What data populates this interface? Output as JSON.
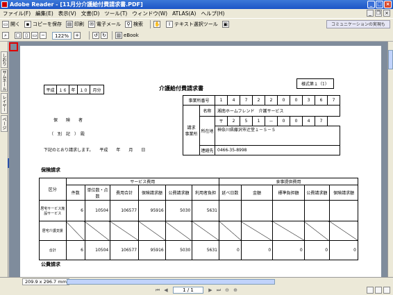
{
  "window": {
    "title": "Adobe Reader - [11月分介護給付費請求書.PDF]"
  },
  "menu": [
    "ファイル(F)",
    "編集(E)",
    "表示(V)",
    "文書(D)",
    "ツール(T)",
    "ウィンドウ(W)",
    "ATLAS(A)",
    "ヘルプ(H)"
  ],
  "toolbar1": {
    "open": "開く",
    "save": "コピーを保存",
    "print": "印刷",
    "email": "電子メール",
    "search": "検索",
    "select_tool": "テキスト選択ツール",
    "communication": "コミュニケーションの実現も"
  },
  "toolbar2": {
    "zoom": "122%",
    "ebook": "eBook"
  },
  "sidebar": {
    "tabs": [
      "しおり",
      "サムネール",
      "レイヤー",
      "ページ"
    ]
  },
  "status": {
    "page_size": "209.9 x 296.7 mm"
  },
  "nav": {
    "page": "1 / 1"
  },
  "doc": {
    "date_label": [
      "平成",
      "１６",
      "年",
      "１０",
      "月分"
    ],
    "title": "介護給付費請求書",
    "form_no": "様式第１（1）",
    "to_label1": "保　　険　　者",
    "to_label2": "（　別　記　）　殿",
    "request_text": "下記のとおり請求します。　　平成　　年　　月　　日",
    "provider_no_label": "事業所番号",
    "provider_no": [
      "1",
      "4",
      "7",
      "2",
      "2",
      "0",
      "0",
      "3",
      "6",
      "7"
    ],
    "name_label": "名称",
    "name": "湘南ホームフレンド　介護サービス",
    "zip": [
      "〒",
      "2",
      "5",
      "1",
      "－",
      "0",
      "0",
      "4",
      "7"
    ],
    "address_label": "所在地",
    "address": "神奈川県藤沢市辻堂１－５－５",
    "phone_label": "連絡先",
    "phone": "0466-35-8998",
    "claimant_label": "請求\n事業所",
    "section1": "保険請求",
    "section2": "公費請求",
    "table": {
      "h_service": "サービス費用",
      "h_meal": "食事提供費用",
      "h_kubun": "区分",
      "cols": [
        "件数",
        "単位数・点数",
        "費用合計",
        "保険請求額",
        "公費請求額",
        "利用者負担",
        "延べ日数",
        "金額",
        "標準負担額",
        "公費請求額",
        "保険請求額"
      ],
      "rows": [
        {
          "label": "居宅サービス施設サービス",
          "vals": [
            "6",
            "10504",
            "106577",
            "95916",
            "5030",
            "5631"
          ]
        },
        {
          "label": "居宅介護支援",
          "vals": [
            "",
            "",
            "",
            "",
            "",
            ""
          ]
        },
        {
          "label": "合計",
          "vals": [
            "6",
            "10504",
            "106577",
            "95916",
            "5030",
            "5631",
            "0",
            "0",
            "0",
            "0",
            "0"
          ]
        }
      ]
    }
  }
}
